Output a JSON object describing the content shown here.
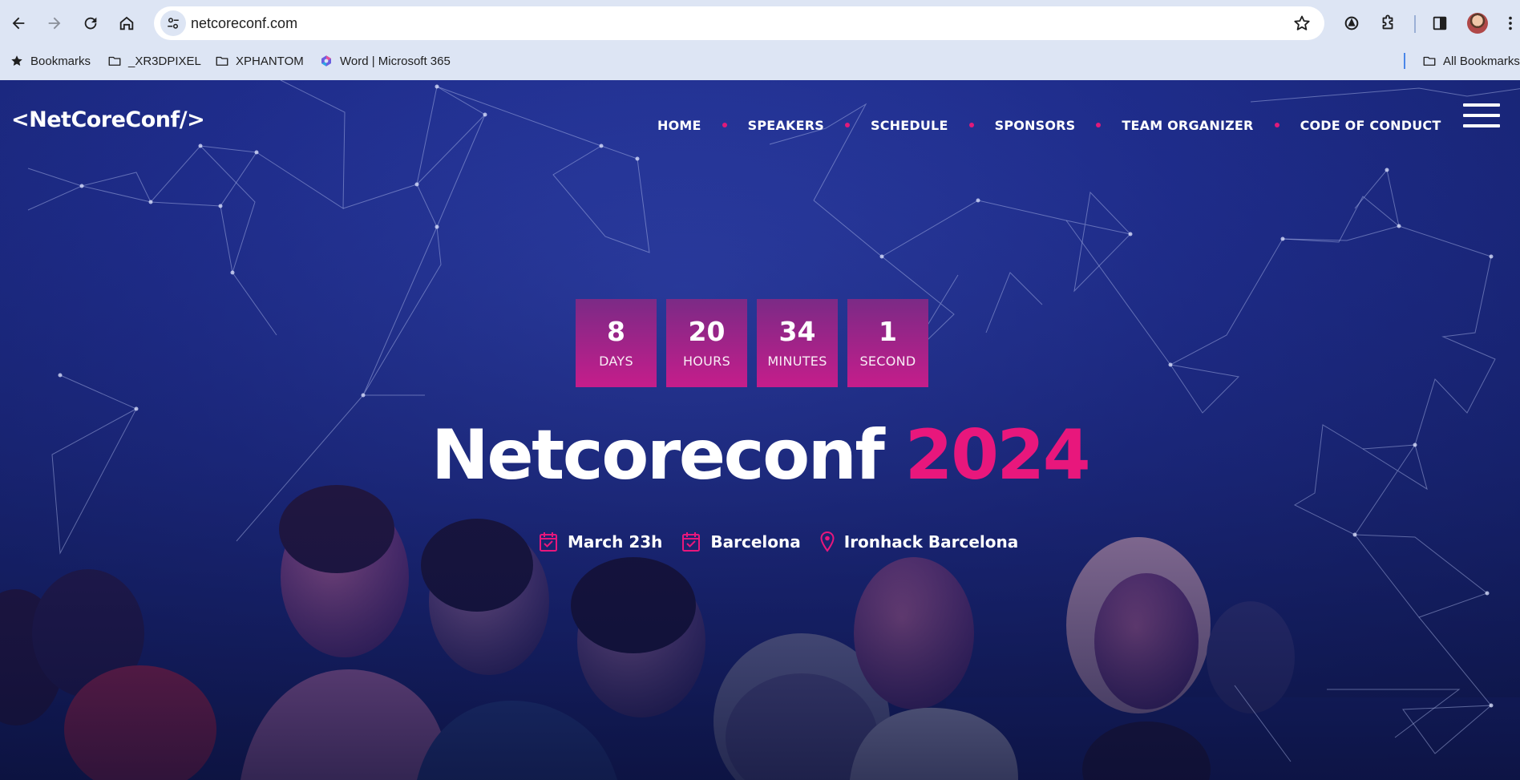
{
  "browser": {
    "url": "netcoreconf.com",
    "bookmarks": [
      {
        "label": "Bookmarks",
        "icon": "star-icon"
      },
      {
        "label": "_XR3DPIXEL",
        "icon": "folder-icon"
      },
      {
        "label": "XPHANTOM",
        "icon": "folder-icon"
      },
      {
        "label": "Word | Microsoft 365",
        "icon": "microsoft-365-icon"
      }
    ],
    "all_bookmarks_label": "All Bookmarks"
  },
  "site": {
    "logo": "<NetCoreConf/>",
    "nav": [
      {
        "label": "HOME"
      },
      {
        "label": "SPEAKERS"
      },
      {
        "label": "SCHEDULE"
      },
      {
        "label": "SPONSORS"
      },
      {
        "label": "TEAM ORGANIZER"
      },
      {
        "label": "CODE OF CONDUCT"
      }
    ],
    "countdown": [
      {
        "value": "8",
        "label": "DAYS"
      },
      {
        "value": "20",
        "label": "HOURS"
      },
      {
        "value": "34",
        "label": "MINUTES"
      },
      {
        "value": "1",
        "label": "SECOND"
      }
    ],
    "title_main": "Netcoreconf",
    "title_year": "2024",
    "meta": [
      {
        "text": "March 23h",
        "icon": "calendar-icon"
      },
      {
        "text": "Barcelona",
        "icon": "calendar-icon"
      },
      {
        "text": "Ironhack Barcelona",
        "icon": "map-pin-icon"
      }
    ]
  },
  "colors": {
    "accent": "#e8177c",
    "hero_background": "#1f2d8c",
    "countdown_top": "#7b2a86",
    "countdown_bottom": "#c51d8b",
    "chrome_background": "#dde5f4"
  }
}
